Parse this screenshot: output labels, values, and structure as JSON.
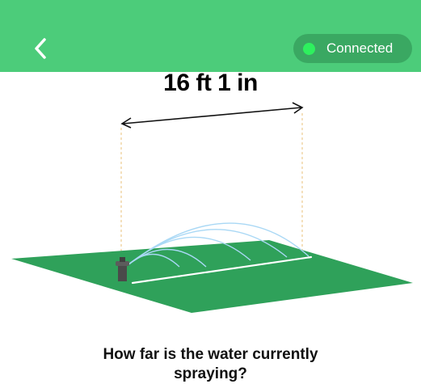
{
  "header": {
    "back_icon": "chevron-left-icon",
    "status": {
      "label": "Connected",
      "dot_color": "#2ef05e"
    },
    "color": "#4ccc7a"
  },
  "measurement": {
    "distance_label": "16 ft 1 in"
  },
  "illustration": {
    "icon": "sprinkler-lawn-illustration",
    "lawn_color": "#2fa15a",
    "spray_color": "#a9d8f5"
  },
  "question": {
    "line1": "How far is the water currently",
    "line2": "spraying?"
  }
}
